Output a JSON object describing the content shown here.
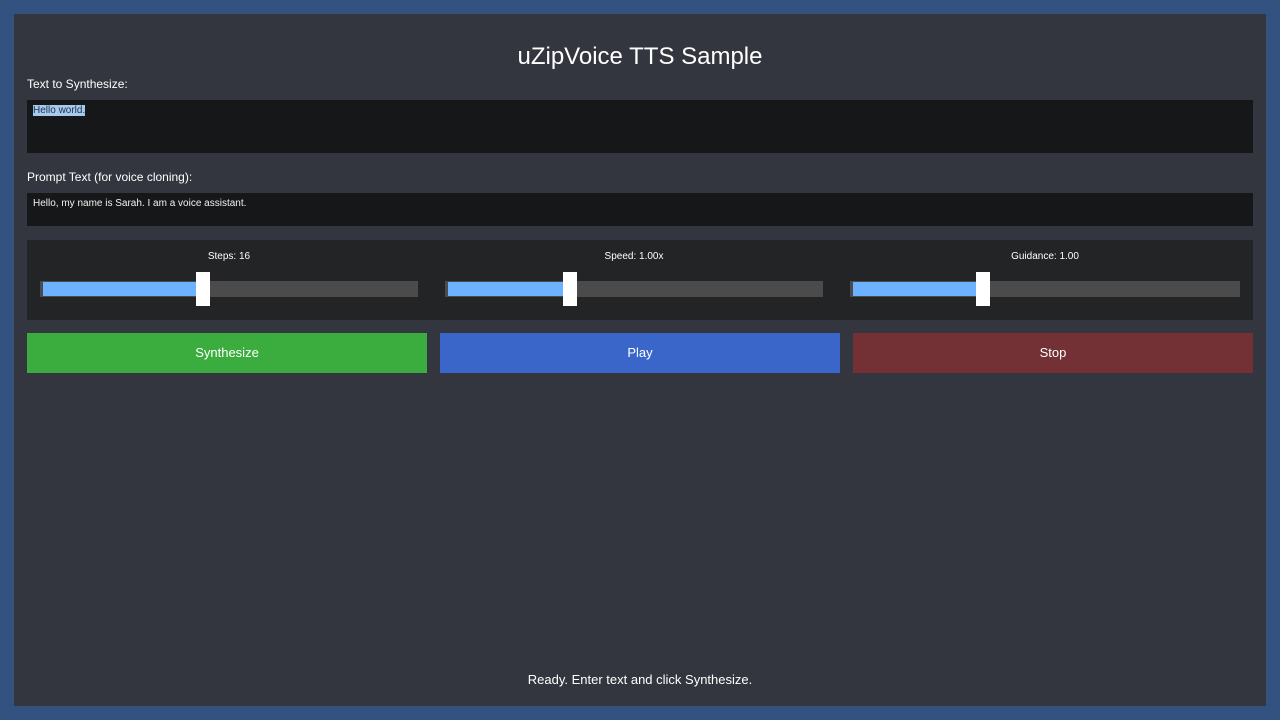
{
  "app": {
    "title": "uZipVoice TTS Sample"
  },
  "text_input": {
    "label": "Text to Synthesize:",
    "value": "Hello world."
  },
  "prompt_input": {
    "label": "Prompt Text (for voice cloning):",
    "value": "Hello, my name is Sarah. I am a voice assistant."
  },
  "sliders": {
    "steps": {
      "label": "Steps: 16",
      "value": 16,
      "fill_fraction": 0.43
    },
    "speed": {
      "label": "Speed: 1.00x",
      "value": 1.0,
      "fill_fraction": 0.33
    },
    "guidance": {
      "label": "Guidance: 1.00",
      "value": 1.0,
      "fill_fraction": 0.34
    }
  },
  "buttons": {
    "synthesize": {
      "label": "Synthesize",
      "color": "#3bad3f"
    },
    "play": {
      "label": "Play",
      "color": "#3a65c9"
    },
    "stop": {
      "label": "Stop",
      "color": "#733035"
    }
  },
  "status": {
    "text": "Ready. Enter text and click Synthesize."
  }
}
